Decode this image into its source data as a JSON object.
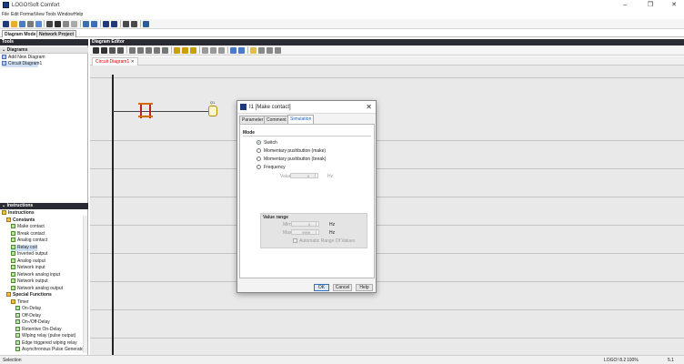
{
  "window": {
    "title": "LOGO!Soft Comfort"
  },
  "menu": [
    "File",
    "Edit",
    "Format",
    "View",
    "Tools",
    "Window",
    "Help"
  ],
  "mode_tabs": [
    "Diagram Mode",
    "Network Project"
  ],
  "tools_panel": {
    "title": "Tools",
    "section": "Diagrams",
    "items": [
      "Add New Diagram",
      "Circuit Diagram1"
    ]
  },
  "instructions_panel": {
    "title": "Instructions",
    "items": [
      {
        "label": "Instructions",
        "level": 0
      },
      {
        "label": "Constants",
        "level": 1
      },
      {
        "label": "Make contact",
        "level": 2
      },
      {
        "label": "Break contact",
        "level": 2
      },
      {
        "label": "Analog contact",
        "level": 2
      },
      {
        "label": "Relay coil",
        "level": 2
      },
      {
        "label": "Inverted output",
        "level": 2
      },
      {
        "label": "Analog output",
        "level": 2
      },
      {
        "label": "Network input",
        "level": 2
      },
      {
        "label": "Network analog input",
        "level": 2
      },
      {
        "label": "Network output",
        "level": 2
      },
      {
        "label": "Network analog output",
        "level": 2
      },
      {
        "label": "Special Functions",
        "level": 1
      },
      {
        "label": "Timer",
        "level": 2
      },
      {
        "label": "On-Delay",
        "level": 3
      },
      {
        "label": "Off-Delay",
        "level": 3
      },
      {
        "label": "On-/Off-Delay",
        "level": 3
      },
      {
        "label": "Retentive On-Delay",
        "level": 3
      },
      {
        "label": "Wiping relay (pulse output)",
        "level": 3
      },
      {
        "label": "Edge triggered wiping relay",
        "level": 3
      },
      {
        "label": "Asynchronous Pulse Generator",
        "level": 3
      }
    ]
  },
  "editor": {
    "title": "Diagram Editor",
    "tab": "Circuit Diagram1",
    "coil_label": "Q1"
  },
  "dialog": {
    "title": "I1 [Make contact]",
    "tabs": [
      "Parameter",
      "Comment",
      "Simulation"
    ],
    "active_tab": "Simulation",
    "mode_label": "Mode",
    "modes": [
      "Switch",
      "Momentary pushbutton (make)",
      "Momentary pushbutton (break)",
      "Frequency"
    ],
    "selected_mode": "Switch",
    "value_label": "Value:",
    "value": "0",
    "value_unit": "Hz",
    "value_range_label": "Value range",
    "min_label": "Min:",
    "min_value": "0",
    "min_unit": "Hz",
    "max_label": "Max:",
    "max_value": "9999",
    "max_unit": "Hz",
    "auto_range_label": "Automatic Range Of Values",
    "buttons": {
      "ok": "OK",
      "cancel": "Cancel",
      "help": "Help"
    }
  },
  "status": {
    "left": "Selection",
    "device": "LOGO! 8.2",
    "zoom": "100%",
    "position": "5.1"
  }
}
